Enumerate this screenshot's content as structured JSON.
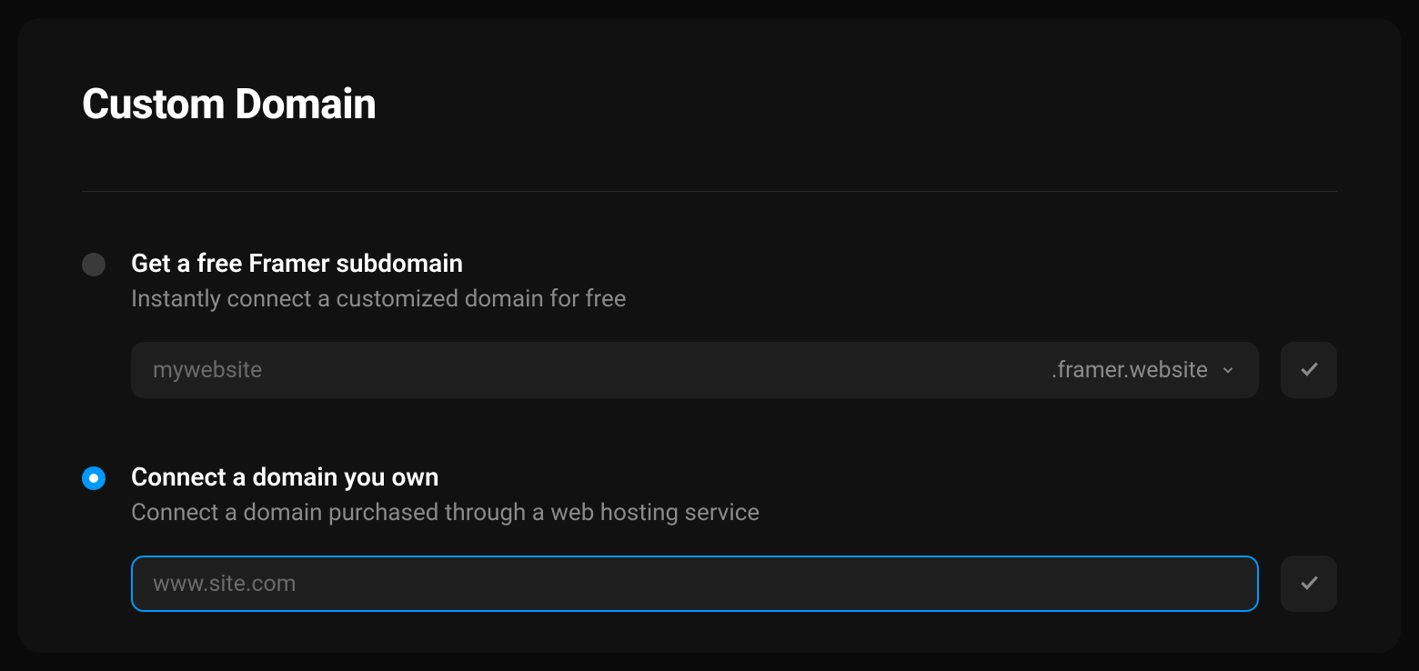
{
  "title": "Custom Domain",
  "options": {
    "subdomain": {
      "title": "Get a free Framer subdomain",
      "desc": "Instantly connect a customized domain for free",
      "input_placeholder": "mywebsite",
      "input_value": "",
      "suffix": ".framer.website",
      "selected": false
    },
    "own_domain": {
      "title": "Connect a domain you own",
      "desc": "Connect a domain purchased through a web hosting service",
      "input_placeholder": "www.site.com",
      "input_value": "",
      "selected": true
    }
  }
}
